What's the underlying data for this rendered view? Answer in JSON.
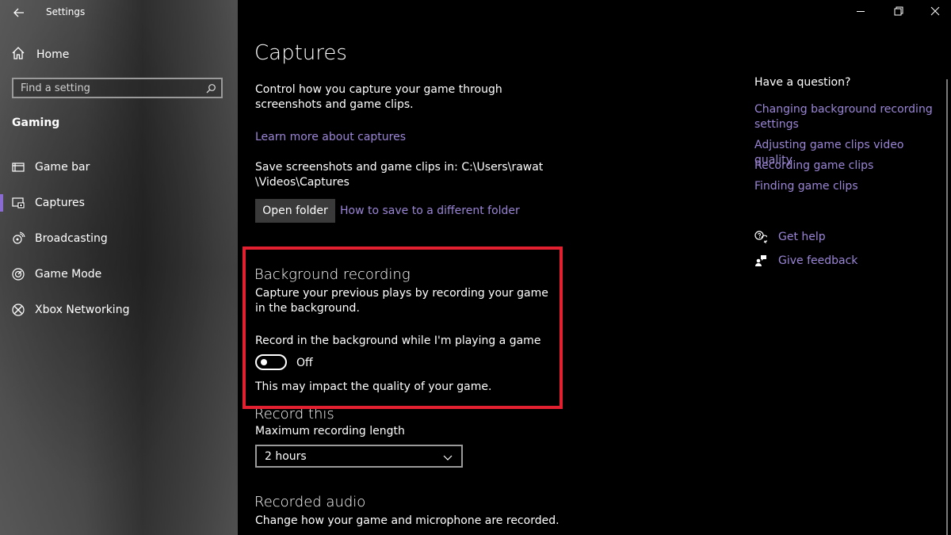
{
  "window": {
    "title": "Settings"
  },
  "sidebar": {
    "home_label": "Home",
    "search_placeholder": "Find a setting",
    "section_title": "Gaming",
    "items": [
      {
        "label": "Game bar",
        "icon": "game-bar-icon",
        "active": false
      },
      {
        "label": "Captures",
        "icon": "captures-icon",
        "active": true
      },
      {
        "label": "Broadcasting",
        "icon": "broadcasting-icon",
        "active": false
      },
      {
        "label": "Game Mode",
        "icon": "game-mode-icon",
        "active": false
      },
      {
        "label": "Xbox Networking",
        "icon": "xbox-icon",
        "active": false
      }
    ]
  },
  "main": {
    "title": "Captures",
    "description": "Control how you capture your game through screenshots and game clips.",
    "learn_more_link": "Learn more about captures",
    "save_location_text": "Save screenshots and game clips in: C:\\Users\\rawat\\Videos\\Captures",
    "open_folder_button": "Open folder",
    "different_folder_link": "How to save to a different folder",
    "background_recording": {
      "heading": "Background recording",
      "description": "Capture your previous plays by recording your game in the background.",
      "toggle_label": "Record in the background while I'm playing a game",
      "toggle_state": "Off",
      "note": "This may impact the quality of your game."
    },
    "record_this": {
      "heading": "Record this",
      "label": "Maximum recording length",
      "selected_value": "2 hours"
    },
    "recorded_audio": {
      "heading": "Recorded audio",
      "description": "Change how your game and microphone are recorded."
    }
  },
  "help": {
    "question": "Have a question?",
    "links": [
      "Changing background recording settings",
      "Adjusting game clips video quality",
      "Recording game clips",
      "Finding game clips"
    ],
    "get_help": "Get help",
    "give_feedback": "Give feedback"
  },
  "colors": {
    "accent_link": "#9b85d6",
    "highlight_border": "#e2202f",
    "background": "#000000"
  }
}
